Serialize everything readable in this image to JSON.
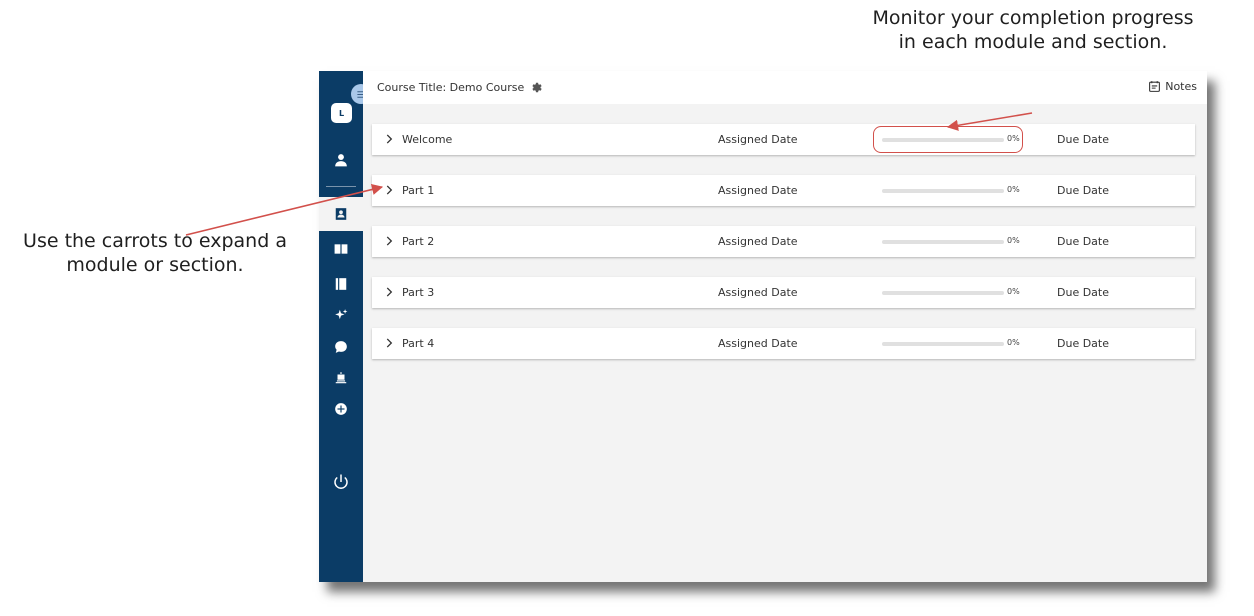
{
  "annotations": {
    "top": "Monitor your completion progress in each module and section.",
    "left": "Use the carrots to expand a module or section."
  },
  "colors": {
    "sidebar": "#0b3c66",
    "annotation_line": "#d2504b",
    "menu_bubble": "#a9c8ea"
  },
  "sidebar": {
    "avatar_initial": "L",
    "icons": [
      "menu-icon",
      "user-icon",
      "contact-card-icon",
      "book-open-icon",
      "book-icon",
      "sparkle-icon",
      "chat-icon",
      "robot-icon",
      "add-circle-icon",
      "power-icon"
    ]
  },
  "header": {
    "course_title": "Course Title: Demo Course",
    "notes_label": "Notes"
  },
  "modules": [
    {
      "title": "Welcome",
      "assigned": "Assigned Date",
      "progress": 0,
      "progress_label": "0%",
      "due": "Due Date"
    },
    {
      "title": "Part 1",
      "assigned": "Assigned Date",
      "progress": 0,
      "progress_label": "0%",
      "due": "Due Date"
    },
    {
      "title": "Part 2",
      "assigned": "Assigned Date",
      "progress": 0,
      "progress_label": "0%",
      "due": "Due Date"
    },
    {
      "title": "Part 3",
      "assigned": "Assigned Date",
      "progress": 0,
      "progress_label": "0%",
      "due": "Due Date"
    },
    {
      "title": "Part 4",
      "assigned": "Assigned Date",
      "progress": 0,
      "progress_label": "0%",
      "due": "Due Date"
    }
  ]
}
